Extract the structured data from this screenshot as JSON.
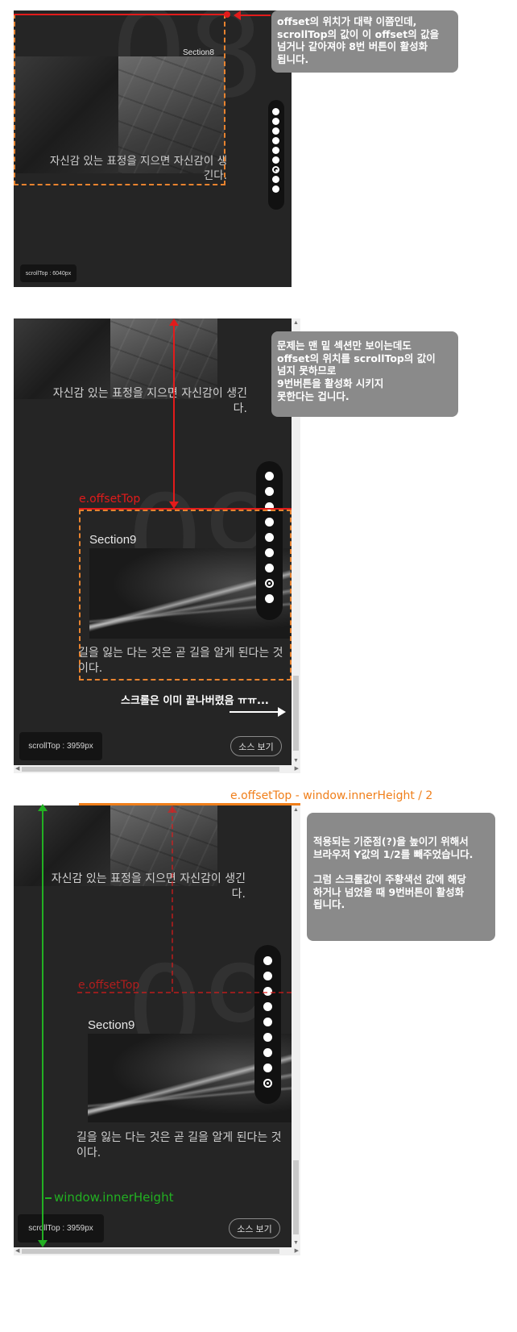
{
  "panel1": {
    "section_label": "Section8",
    "caption": "자신감 있는 표정을 지으면 자신감이 생긴다.",
    "scrolltop": "scrollTop : 6040px",
    "bg_number": "08",
    "note": "offset의 위치가 대략 이쯤인데,\nscrollTop의 값이 이 offset의 값을\n넘거나 같아져야 8번 버튼이 활성화\n됩니다.",
    "nav_dots": 9,
    "active_dot": 7
  },
  "panel2": {
    "prev_caption": "자신감 있는 표정을 지으면 자신감이 생긴다.",
    "section_label": "Section9",
    "caption": "길을 잃는 다는 것은 곧 길을 알게 된다는 것이다.",
    "scrolltop": "scrollTop : 3959px",
    "source_button": "소스 보기",
    "offset_label": "e.offsetTop",
    "scroll_done_note": "스크롤은 이미 끝나버렸음 ㅠㅠ...",
    "note": "문제는 맨 밑 섹션만 보이는데도\noffset의 위치를 scrollTop의 값이\n넘지 못하므로\n9번버튼을 활성화 시키지\n못한다는 겁니다.",
    "nav_dots": 9,
    "active_dot": 8
  },
  "panel3": {
    "formula_label": "e.offsetTop - window.innerHeight / 2",
    "prev_caption": "자신감 있는 표정을 지으면 자신감이 생긴다.",
    "offset_label": "e.offsetTop",
    "section_label": "Section9",
    "caption": "길을 잃는 다는 것은 곧 길을 알게 된다는 것이다.",
    "inner_height_label": "window.innerHeight",
    "scrolltop": "scrollTop : 3959px",
    "source_button": "소스 보기",
    "note": "적용되는 기준점(?)을 높이기 위해서\n브라우저 Y값의 1/2를 빼주었습니다.\n\n그럼 스크롤값이 주황색선 값에 해당\n하거나 넘었을 때 9번버튼이 활성화\n됩니다.",
    "nav_dots": 9,
    "active_dot": 8
  },
  "colors": {
    "panel_bg": "#252525",
    "note_bg": "#8a8a8a",
    "annotation_red": "#e21b1b",
    "annotation_orange": "#f07f1a",
    "annotation_green": "#22b022"
  }
}
